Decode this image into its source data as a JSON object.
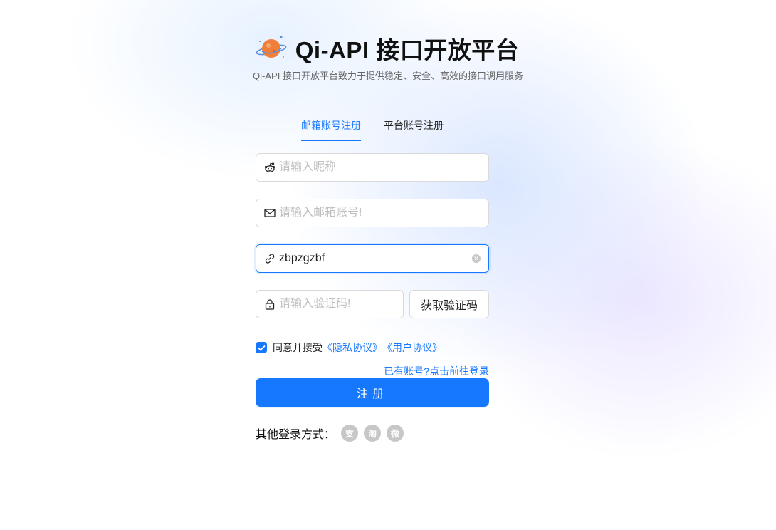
{
  "header": {
    "title": "Qi-API 接口开放平台",
    "subtitle": "Qi-API 接口开放平台致力于提供稳定、安全、高效的接口调用服务"
  },
  "tabs": [
    {
      "label": "邮箱账号注册",
      "active": true
    },
    {
      "label": "平台账号注册",
      "active": false
    }
  ],
  "form": {
    "nickname_placeholder": "请输入昵称",
    "email_placeholder": "请输入邮箱账号!",
    "invite_value": "zbpzgzbf",
    "code_placeholder": "请输入验证码!",
    "get_code_label": "获取验证码",
    "agree_prefix": "同意并接受",
    "privacy_link": "《隐私协议》",
    "user_link": "《用户协议》",
    "login_link": "已有账号?点击前往登录",
    "submit_label": "注册"
  },
  "other_login": {
    "label": "其他登录方式：",
    "icons": [
      {
        "name": "alipay-icon",
        "glyph": "支"
      },
      {
        "name": "taobao-icon",
        "glyph": "淘"
      },
      {
        "name": "weibo-icon",
        "glyph": "微"
      }
    ]
  },
  "colors": {
    "accent": "#1677ff",
    "border": "#d9d9d9",
    "placeholder": "#bfbfbf"
  }
}
